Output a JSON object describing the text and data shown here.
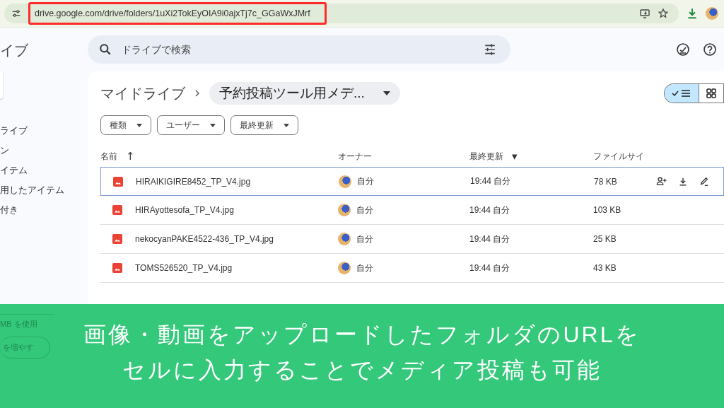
{
  "browser": {
    "url": "drive.google.com/drive/folders/1uXi2TokEyOIA9i0ajxTj7c_GGaWxJMrf",
    "url_highlighted": true
  },
  "sidebar": {
    "title": "イブ",
    "items": [
      {
        "label": "ライブ"
      },
      {
        "label": "ン"
      },
      {
        "label": "イテム"
      },
      {
        "label": "用したアイテム"
      },
      {
        "label": "付き"
      }
    ],
    "storage_usage": "MB を使用",
    "storage_button": "を増やす"
  },
  "search": {
    "placeholder": "ドライブで検索"
  },
  "breadcrumb": {
    "root": "マイドライブ",
    "current": "予約投稿ツール用メデ..."
  },
  "view_toggle": [
    {
      "kind": "list",
      "selected": true
    },
    {
      "kind": "grid",
      "selected": false
    }
  ],
  "filters": [
    "種類",
    "ユーザー",
    "最終更新"
  ],
  "table": {
    "columns": [
      {
        "label": "名前",
        "sort_mark": "↑"
      },
      {
        "label": "オーナー"
      },
      {
        "label": "最終更新",
        "sort_mark": "▾"
      },
      {
        "label": "ファイルサイ"
      }
    ],
    "rows": [
      {
        "name": "HIRAIKIGIRE8452_TP_V4.jpg",
        "owner": "自分",
        "modified": "19:44 自分",
        "size": "78 KB",
        "selected": true
      },
      {
        "name": "HIRAyottesofa_TP_V4.jpg",
        "owner": "自分",
        "modified": "19:44 自分",
        "size": "103 KB",
        "selected": false
      },
      {
        "name": "nekocyanPAKE4522-436_TP_V4.jpg",
        "owner": "自分",
        "modified": "19:44 自分",
        "size": "25 KB",
        "selected": false
      },
      {
        "name": "TOMS526520_TP_V4.jpg",
        "owner": "自分",
        "modified": "19:44 自分",
        "size": "43 KB",
        "selected": false
      }
    ]
  },
  "caption": [
    "画像・動画をアップロードしたフォルダのURLを",
    "セルに入力することでメディア投稿も可能"
  ]
}
